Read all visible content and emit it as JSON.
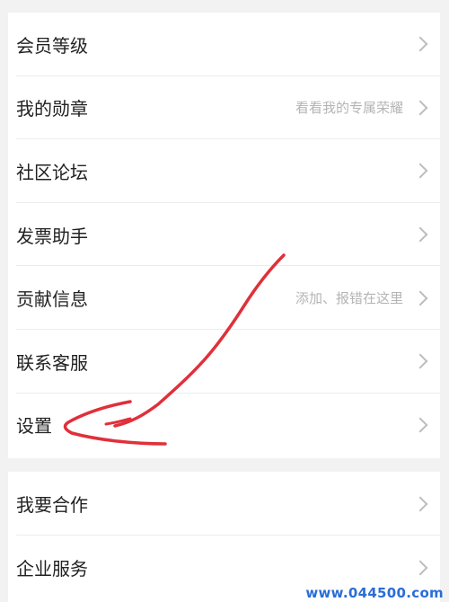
{
  "menu_group_1": [
    {
      "label": "会员等级",
      "hint": ""
    },
    {
      "label": "我的勋章",
      "hint": "看看我的专属荣耀"
    },
    {
      "label": "社区论坛",
      "hint": ""
    },
    {
      "label": "发票助手",
      "hint": ""
    },
    {
      "label": "贡献信息",
      "hint": "添加、报错在这里"
    },
    {
      "label": "联系客服",
      "hint": ""
    },
    {
      "label": "设置",
      "hint": ""
    }
  ],
  "menu_group_2": [
    {
      "label": "我要合作",
      "hint": ""
    },
    {
      "label": "企业服务",
      "hint": ""
    }
  ],
  "watermark": "www.044500.com",
  "colors": {
    "annotation": "#e0303a",
    "watermark": "#2a6dd6"
  },
  "icons": {
    "row_arrow": "chevron-right-icon"
  }
}
